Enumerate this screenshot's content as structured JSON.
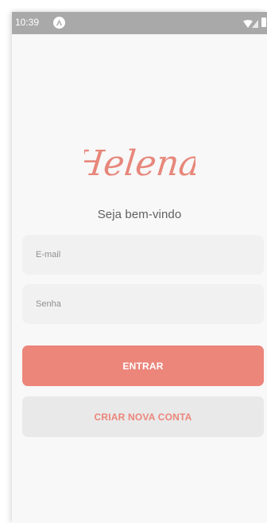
{
  "status_bar": {
    "time": "10:39",
    "app_icon": "android-notification-icon",
    "wifi_icon": "wifi-icon",
    "signal_icon": "cell-signal-icon",
    "battery_icon": "battery-icon"
  },
  "logo": {
    "text": "Helena",
    "color": "#e7877b"
  },
  "welcome_text": "Seja bem-vindo",
  "form": {
    "email_placeholder": "E-mail",
    "password_placeholder": "Senha"
  },
  "buttons": {
    "login_label": "ENTRAR",
    "create_account_label": "CRIAR NOVA CONTA"
  },
  "colors": {
    "accent": "#ec857a",
    "status_bar": "#a9a9a9",
    "background": "#f8f8f8",
    "input_background": "#f1f1f1",
    "secondary_button": "#e9e9e9"
  }
}
